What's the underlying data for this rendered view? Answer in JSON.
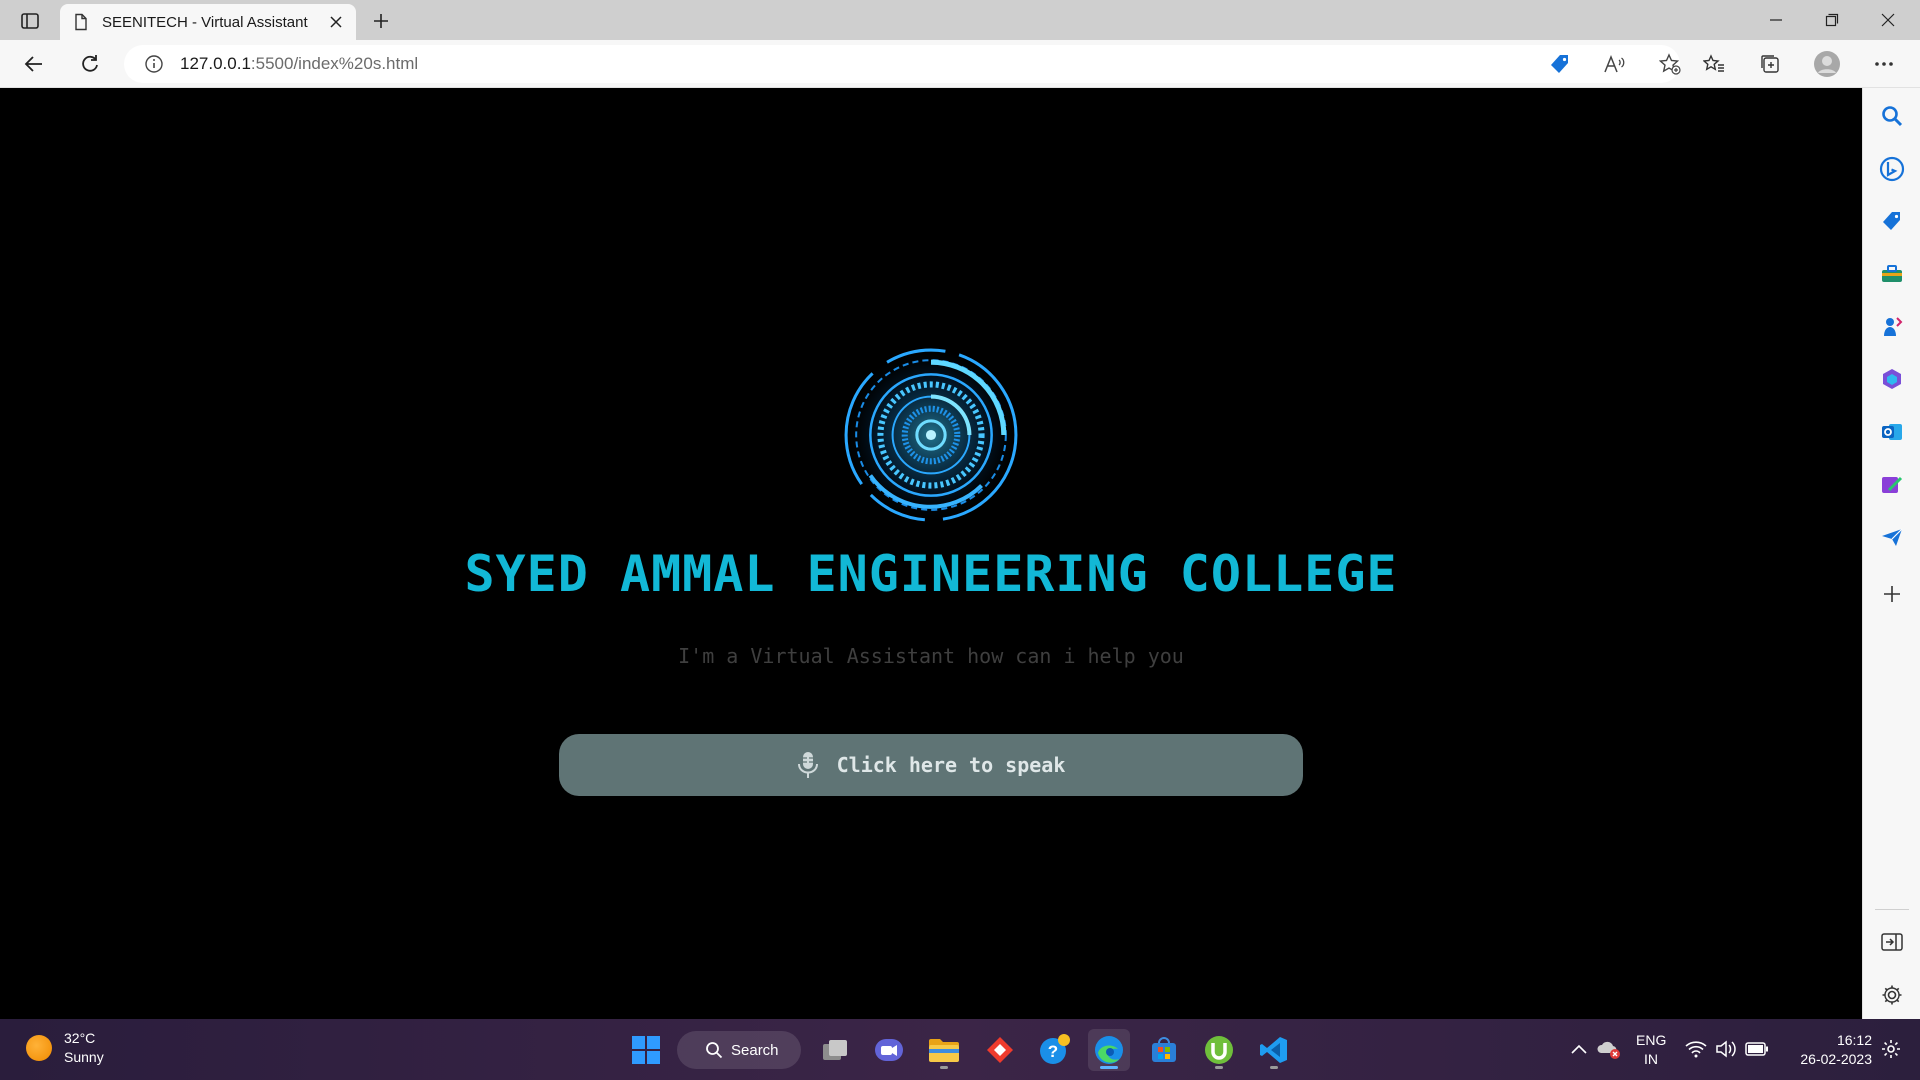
{
  "browser": {
    "tab_title": "SEENITECH - Virtual Assistant",
    "url_host": "127.0.0.1",
    "url_path": ":5500/index%20s.html"
  },
  "page": {
    "headline": "SYED AMMAL ENGINEERING COLLEGE",
    "subtitle": "I'm a Virtual Assistant how can i help you",
    "speak_button_label": "Click here to speak",
    "colors": {
      "headline": "#12b8d6",
      "button_bg": "#5f7475",
      "subtitle": "#3f3f3f"
    }
  },
  "sidebar": {
    "items": [
      "search-icon",
      "bing-chat-icon",
      "shopping-tag-icon",
      "tools-icon",
      "games-icon",
      "office-icon",
      "outlook-icon",
      "designer-icon",
      "send-icon",
      "add-icon",
      "split-screen-icon",
      "settings-icon"
    ]
  },
  "taskbar": {
    "weather_temp": "32°C",
    "weather_desc": "Sunny",
    "search_label": "Search",
    "lang_line1": "ENG",
    "lang_line2": "IN",
    "time": "16:12",
    "date": "26-02-2023"
  }
}
